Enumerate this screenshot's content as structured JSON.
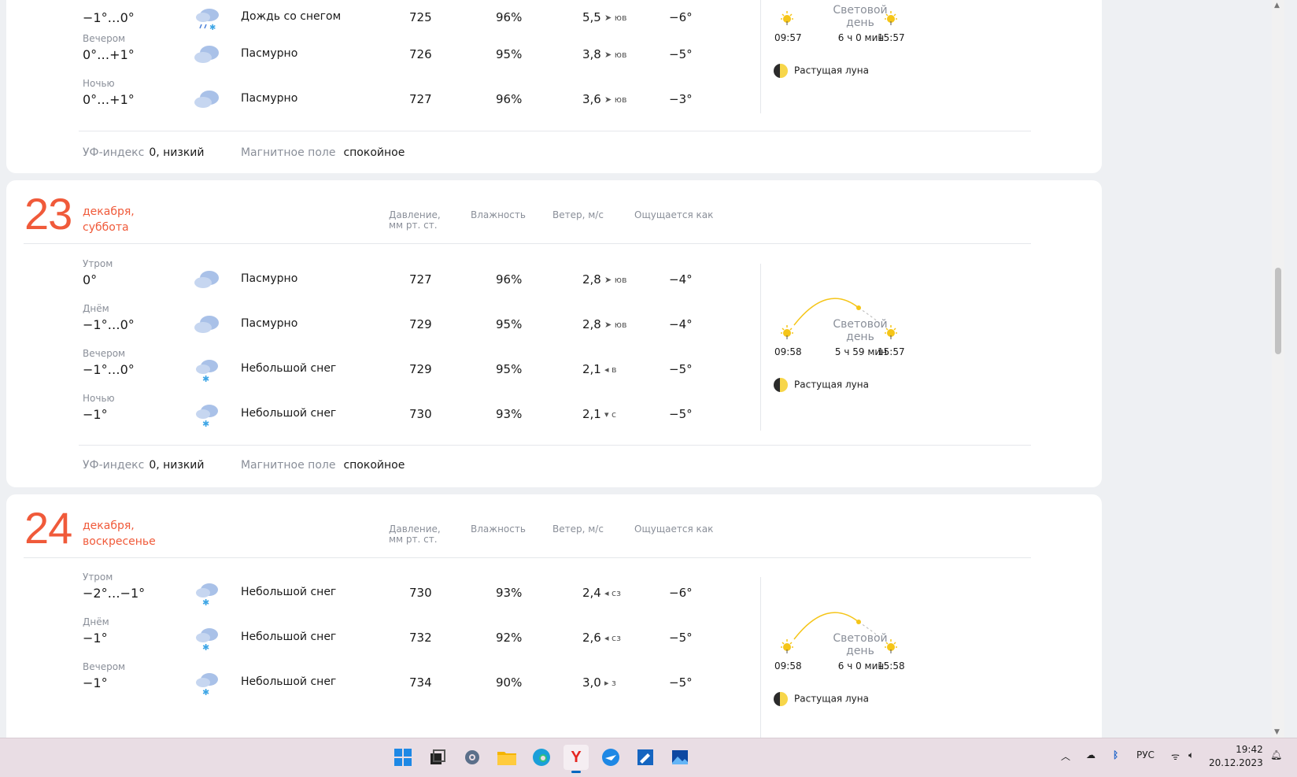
{
  "labels": {
    "pressure": "Давление,",
    "pressure_unit": "мм рт. ст.",
    "humidity": "Влажность",
    "wind": "Ветер, м/с",
    "feels": "Ощущается как",
    "daylight": "Световой",
    "daylight2": "день",
    "uv": "УФ-индекс",
    "magnetic": "Магнитное поле",
    "moon": "Растущая луна"
  },
  "day22": {
    "rows": [
      {
        "part": "",
        "temp": "−1°…0°",
        "cond": "Дождь со снегом",
        "icon": "rain-snow-icon",
        "press": "725",
        "hum": "96%",
        "wind": "5,5",
        "dir": "ЮВ",
        "feel": "−6°"
      },
      {
        "part": "Вечером",
        "temp": "0°…+1°",
        "cond": "Пасмурно",
        "icon": "overcast-icon",
        "press": "726",
        "hum": "95%",
        "wind": "3,8",
        "dir": "ЮВ",
        "feel": "−5°"
      },
      {
        "part": "Ночью",
        "temp": "0°…+1°",
        "cond": "Пасмурно",
        "icon": "overcast-icon",
        "press": "727",
        "hum": "96%",
        "wind": "3,6",
        "dir": "ЮВ",
        "feel": "−3°"
      }
    ],
    "sunrise": "09:57",
    "sunset": "15:57",
    "daylen": "6 ч 0 мин",
    "uv": "0, низкий",
    "magnetic": "спокойное"
  },
  "day23": {
    "num": "23",
    "month": "декабря,",
    "weekday": "суббота",
    "rows": [
      {
        "part": "Утром",
        "temp": "0°",
        "cond": "Пасмурно",
        "icon": "overcast-icon",
        "press": "727",
        "hum": "96%",
        "wind": "2,8",
        "dir": "ЮВ",
        "feel": "−4°"
      },
      {
        "part": "Днём",
        "temp": "−1°…0°",
        "cond": "Пасмурно",
        "icon": "overcast-icon",
        "press": "729",
        "hum": "95%",
        "wind": "2,8",
        "dir": "ЮВ",
        "feel": "−4°"
      },
      {
        "part": "Вечером",
        "temp": "−1°…0°",
        "cond": "Небольшой снег",
        "icon": "light-snow-icon",
        "press": "729",
        "hum": "95%",
        "wind": "2,1",
        "dir": "В",
        "feel": "−5°"
      },
      {
        "part": "Ночью",
        "temp": "−1°",
        "cond": "Небольшой снег",
        "icon": "light-snow-icon",
        "press": "730",
        "hum": "93%",
        "wind": "2,1",
        "dir": "С",
        "feel": "−5°"
      }
    ],
    "sunrise": "09:58",
    "sunset": "15:57",
    "daylen": "5 ч 59 мин",
    "uv": "0, низкий",
    "magnetic": "спокойное"
  },
  "day24": {
    "num": "24",
    "month": "декабря,",
    "weekday": "воскресенье",
    "rows": [
      {
        "part": "Утром",
        "temp": "−2°…−1°",
        "cond": "Небольшой снег",
        "icon": "light-snow-icon",
        "press": "730",
        "hum": "93%",
        "wind": "2,4",
        "dir": "СЗ",
        "feel": "−6°"
      },
      {
        "part": "Днём",
        "temp": "−1°",
        "cond": "Небольшой снег",
        "icon": "light-snow-icon",
        "press": "732",
        "hum": "92%",
        "wind": "2,6",
        "dir": "СЗ",
        "feel": "−5°"
      },
      {
        "part": "Вечером",
        "temp": "−1°",
        "cond": "Небольшой снег",
        "icon": "light-snow-icon",
        "press": "734",
        "hum": "90%",
        "wind": "3,0",
        "dir": "З",
        "feel": "−5°"
      }
    ],
    "sunrise": "09:58",
    "sunset": "15:58",
    "daylen": "6 ч 0 мин"
  },
  "taskbar": {
    "lang": "РУС",
    "time": "19:42",
    "date": "20.12.2023"
  },
  "colors": {
    "accent": "#f05a3a",
    "muted": "#8a8f99",
    "sun": "#f5c518"
  }
}
